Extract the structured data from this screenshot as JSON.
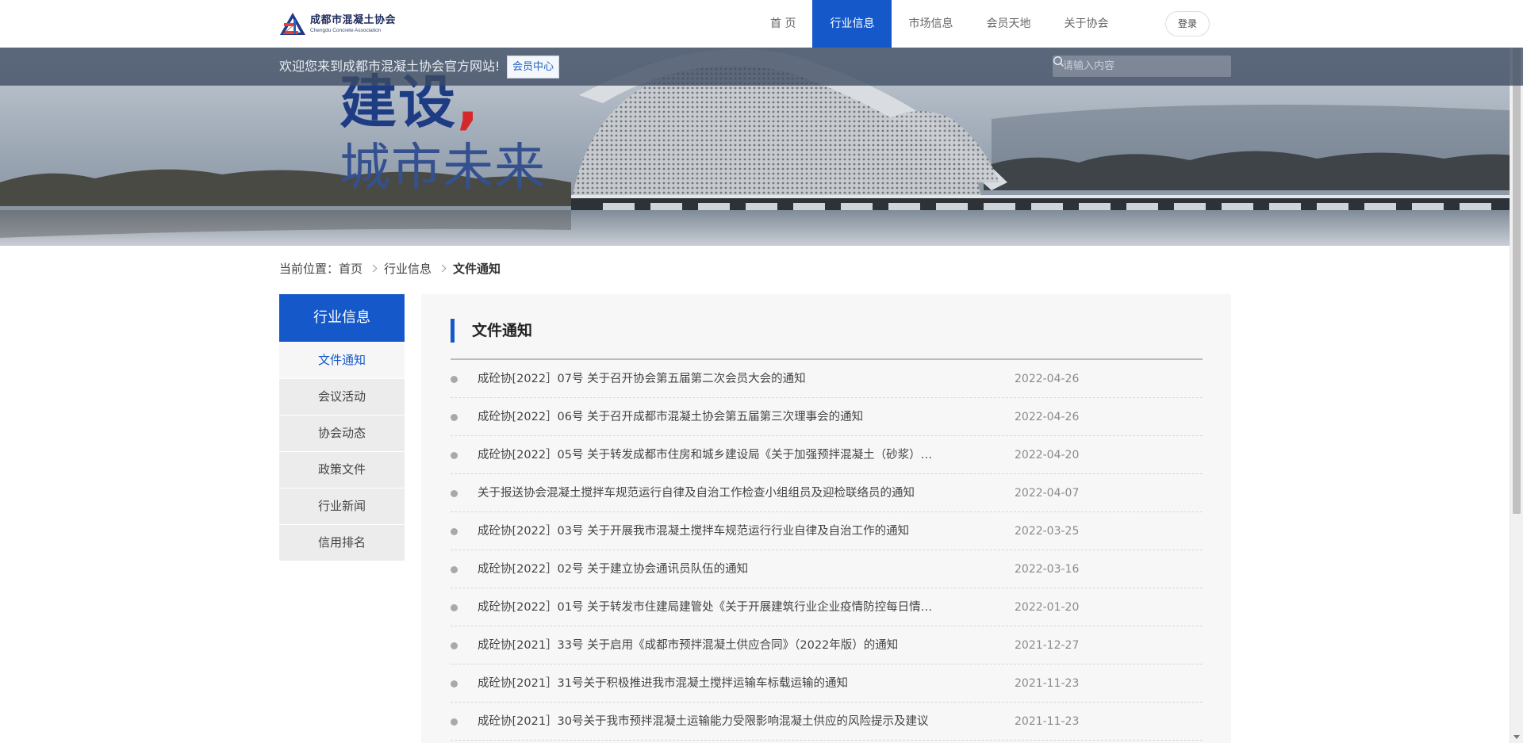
{
  "header": {
    "logo_cn": "成都市混凝土协会",
    "logo_en": "Chengdu Concrete Association",
    "nav": [
      {
        "label": "首  页",
        "active": false
      },
      {
        "label": "行业信息",
        "active": true
      },
      {
        "label": "市场信息",
        "active": false
      },
      {
        "label": "会员天地",
        "active": false
      },
      {
        "label": "关于协会",
        "active": false
      }
    ],
    "login_label": "登录"
  },
  "banner": {
    "welcome": "欢迎您来到成都市混凝土协会官方网站!",
    "member_center": "会员中心",
    "search_placeholder": "请输入内容",
    "slogan_line1": "建设",
    "slogan_comma": ",",
    "slogan_line2": "城市未来"
  },
  "breadcrumb": {
    "prefix": "当前位置：",
    "items": [
      "首页",
      "行业信息",
      "文件通知"
    ]
  },
  "sidebar": {
    "heading": "行业信息",
    "items": [
      {
        "label": "文件通知",
        "active": true
      },
      {
        "label": "会议活动",
        "active": false
      },
      {
        "label": "协会动态",
        "active": false
      },
      {
        "label": "政策文件",
        "active": false
      },
      {
        "label": "行业新闻",
        "active": false
      },
      {
        "label": "信用排名",
        "active": false
      }
    ]
  },
  "main": {
    "title": "文件通知",
    "rows": [
      {
        "title": "成砼协[2022］07号  关于召开协会第五届第二次会员大会的通知",
        "date": "2022-04-26"
      },
      {
        "title": "成砼协[2022］06号  关于召开成都市混凝土协会第五届第三次理事会的通知",
        "date": "2022-04-26"
      },
      {
        "title": "成砼协[2022］05号  关于转发成都市住房和城乡建设局《关于加强预拌混凝土（砂浆）…",
        "date": "2022-04-20"
      },
      {
        "title": "关于报送协会混凝土搅拌车规范运行自律及自治工作检查小组组员及迎检联络员的通知",
        "date": "2022-04-07"
      },
      {
        "title": "成砼协[2022］03号  关于开展我市混凝土搅拌车规范运行行业自律及自治工作的通知",
        "date": "2022-03-25"
      },
      {
        "title": "成砼协[2022］02号  关于建立协会通讯员队伍的通知",
        "date": "2022-03-16"
      },
      {
        "title": "成砼协[2022］01号  关于转发市住建局建管处《关于开展建筑行业企业疫情防控每日情…",
        "date": "2022-01-20"
      },
      {
        "title": "成砼协[2021］33号  关于启用《成都市预拌混凝土供应合同》（2022年版）的通知",
        "date": "2021-12-27"
      },
      {
        "title": "成砼协[2021］31号关于积极推进我市混凝土搅拌运输车标载运输的通知",
        "date": "2021-11-23"
      },
      {
        "title": "成砼协[2021］30号关于我市预拌混凝土运输能力受限影响混凝土供应的风险提示及建议",
        "date": "2021-11-23"
      }
    ]
  },
  "colors": {
    "accent": "#1558c9",
    "slogan_blue": "#1e3c84",
    "slogan_red": "#d4282a"
  }
}
